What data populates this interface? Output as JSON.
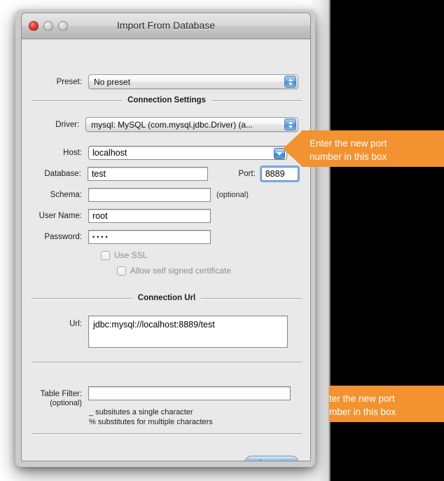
{
  "window": {
    "title": "Import From Database",
    "traffic_lights": [
      "close",
      "minimize",
      "zoom"
    ]
  },
  "form": {
    "preset": {
      "label": "Preset:",
      "value": "No preset"
    },
    "sections": {
      "connection_settings": "Connection Settings",
      "connection_url": "Connection Url"
    },
    "driver": {
      "label": "Driver:",
      "value": "mysql: MySQL (com.mysql.jdbc.Driver)  (a..."
    },
    "host": {
      "label": "Host:",
      "value": "localhost"
    },
    "database": {
      "label": "Database:",
      "value": "test"
    },
    "port": {
      "label": "Port:",
      "value": "8889"
    },
    "schema": {
      "label": "Schema:",
      "value": "",
      "hint": "(optional)"
    },
    "username": {
      "label": "User Name:",
      "value": "root"
    },
    "password": {
      "label": "Password:",
      "value": "••••"
    },
    "use_ssl": {
      "label": "Use SSL",
      "checked": false
    },
    "allow_self_signed": {
      "label": "Allow self signed certificate",
      "checked": false
    },
    "url": {
      "label": "Url:",
      "value": "jdbc:mysql://localhost:8889/test"
    },
    "table_filter": {
      "label": "Table Filter:",
      "sublabel": "(optional)",
      "value": "",
      "hint_line1": "_ subsitutes a single character",
      "hint_line2": "% substitutes for multiple characters"
    },
    "import_button": "Import"
  },
  "callouts": {
    "primary": "Enter the new port\nnumber in this box",
    "secondary": "ter the new port\nmber in this box"
  },
  "colors": {
    "callout_orange": "#f29230",
    "window_bg": "#e9e9e9",
    "backdrop": "#000000",
    "accent_blue": "#4f93de"
  }
}
